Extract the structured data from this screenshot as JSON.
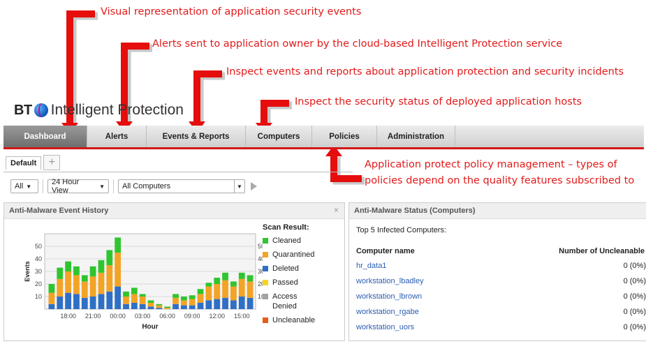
{
  "annotations": [
    "Visual representation of application security events",
    "Alerts sent to application owner by the cloud-based Intelligent Protection service",
    "Inspect events and reports about application protection and security incidents",
    "Inspect the security status of deployed application hosts"
  ],
  "annotation_policy": [
    "Application protect policy management – types of",
    "policies depend on the quality features subscribed to"
  ],
  "logo": {
    "bt": "BT",
    "product": "Intelligent Protection"
  },
  "nav": {
    "tabs": [
      "Dashboard",
      "Alerts",
      "Events & Reports",
      "Computers",
      "Policies",
      "Administration"
    ],
    "active": "Dashboard"
  },
  "subtabs": {
    "default": "Default",
    "add": "+"
  },
  "toolbar": {
    "severity": "All",
    "view": "24 Hour View",
    "computers": "All Computers"
  },
  "history_panel": {
    "title": "Anti-Malware Event History",
    "close": "×",
    "legend_title": "Scan Result:",
    "legend": [
      {
        "label": "Cleaned",
        "color": "#2fc52f"
      },
      {
        "label": "Quarantined",
        "color": "#f3a325"
      },
      {
        "label": "Deleted",
        "color": "#2f6fc6"
      },
      {
        "label": "Passed",
        "color": "#f6d31f"
      },
      {
        "label": "Access Denied",
        "color": "#a3a3a3"
      },
      {
        "label": "Uncleanable",
        "color": "#e85b14"
      }
    ]
  },
  "chart_data": {
    "type": "bar",
    "stacked": true,
    "xlabel": "Hour",
    "ylabel": "Events",
    "ylim": [
      0,
      60
    ],
    "yticks": [
      10,
      20,
      30,
      40,
      50
    ],
    "grid": true,
    "xtick_labels": [
      "18:00",
      "21:00",
      "00:00",
      "03:00",
      "06:00",
      "09:00",
      "12:00",
      "15:00"
    ],
    "series": [
      {
        "name": "Deleted",
        "color": "#2f6fc6",
        "values": [
          4,
          10,
          13,
          12,
          9,
          10,
          12,
          14,
          18,
          4,
          5,
          4,
          2,
          1,
          0,
          4,
          3,
          3,
          5,
          7,
          8,
          9,
          7,
          10,
          9
        ]
      },
      {
        "name": "Quarantined",
        "color": "#f3a325",
        "values": [
          9,
          14,
          17,
          15,
          13,
          16,
          17,
          21,
          27,
          6,
          7,
          6,
          3,
          2,
          1,
          5,
          4,
          5,
          7,
          11,
          12,
          14,
          11,
          14,
          13
        ]
      },
      {
        "name": "Cleaned",
        "color": "#2fc52f",
        "values": [
          7,
          9,
          8,
          7,
          5,
          8,
          10,
          12,
          12,
          4,
          5,
          2,
          2,
          1,
          1,
          3,
          3,
          3,
          4,
          3,
          5,
          6,
          4,
          5,
          5
        ]
      }
    ]
  },
  "status_panel": {
    "title": "Anti-Malware Status (Computers)",
    "subtitle": "Top 5 Infected Computers:",
    "col_name": "Computer name",
    "col_value": "Number of Uncleanable",
    "rows": [
      {
        "name": "hr_data1",
        "value": "0 (0%)"
      },
      {
        "name": "workstation_lbadley",
        "value": "0 (0%)"
      },
      {
        "name": "workstation_lbrown",
        "value": "0 (0%)"
      },
      {
        "name": "workstation_rgabe",
        "value": "0 (0%)"
      },
      {
        "name": "workstation_uors",
        "value": "0 (0%)"
      }
    ]
  }
}
